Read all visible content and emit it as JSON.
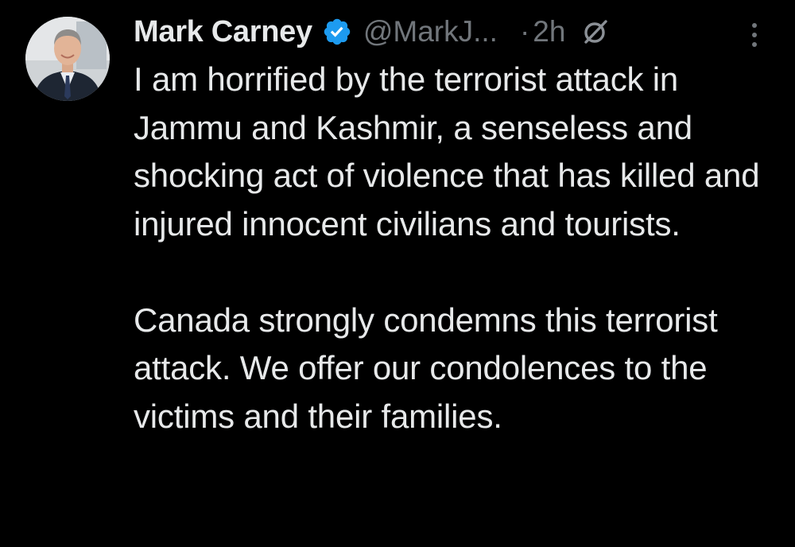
{
  "tweet": {
    "author": {
      "display_name": "Mark Carney",
      "handle": "@MarkJ...",
      "verified": true,
      "avatar_icon": "profile-photo"
    },
    "timestamp_separator": "·",
    "timestamp": "2h",
    "icons": {
      "verified": "verified-badge-icon",
      "grok": "grok-icon",
      "more": "more-options-icon"
    },
    "body": {
      "paragraph_1": "I am horrified by the terrorist attack in Jammu and Kashmir, a senseless and shocking act of violence that has killed and injured innocent civilians and tourists.",
      "paragraph_2": "Canada strongly condemns this terrorist attack. We offer our condolences to the victims and their families."
    }
  },
  "colors": {
    "background": "#000000",
    "text_primary": "#e7e9ea",
    "text_secondary": "#71767b",
    "verified_blue": "#1d9bf0"
  }
}
